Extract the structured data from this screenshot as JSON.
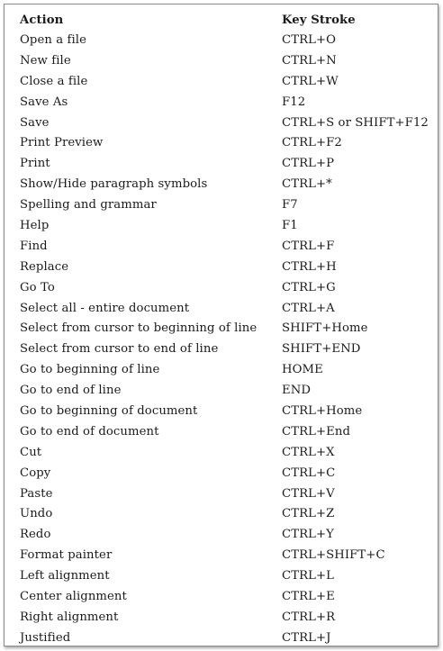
{
  "header": {
    "action": "Action",
    "key_stroke": "Key Stroke"
  },
  "rows": [
    {
      "action": "Open a file",
      "key": "CTRL+O"
    },
    {
      "action": "New file",
      "key": "CTRL+N"
    },
    {
      "action": "Close a file",
      "key": "CTRL+W"
    },
    {
      "action": "Save As",
      "key": "F12"
    },
    {
      "action": "Save",
      "key": "CTRL+S or SHIFT+F12"
    },
    {
      "action": "Print Preview",
      "key": "CTRL+F2"
    },
    {
      "action": "Print",
      "key": "CTRL+P"
    },
    {
      "action": "Show/Hide paragraph symbols",
      "key": "CTRL+*"
    },
    {
      "action": "Spelling and grammar",
      "key": "F7"
    },
    {
      "action": "Help",
      "key": "F1"
    },
    {
      "action": "Find",
      "key": "CTRL+F"
    },
    {
      "action": "Replace",
      "key": "CTRL+H"
    },
    {
      "action": "Go To",
      "key": "CTRL+G"
    },
    {
      "action": "Select all - entire document",
      "key": "CTRL+A"
    },
    {
      "action": "Select from cursor to beginning of line",
      "key": "SHIFT+Home"
    },
    {
      "action": "Select from cursor to end of line",
      "key": "SHIFT+END"
    },
    {
      "action": "Go to beginning of line",
      "key": "HOME"
    },
    {
      "action": "Go to end of line",
      "key": "END"
    },
    {
      "action": "Go to beginning of document",
      "key": "CTRL+Home"
    },
    {
      "action": "Go to end of document",
      "key": "CTRL+End"
    },
    {
      "action": "Cut",
      "key": "CTRL+X"
    },
    {
      "action": "Copy",
      "key": "CTRL+C"
    },
    {
      "action": "Paste",
      "key": "CTRL+V"
    },
    {
      "action": "Undo",
      "key": "CTRL+Z"
    },
    {
      "action": "Redo",
      "key": "CTRL+Y"
    },
    {
      "action": "Format painter",
      "key": "CTRL+SHIFT+C"
    },
    {
      "action": "Left alignment",
      "key": "CTRL+L"
    },
    {
      "action": "Center alignment",
      "key": "CTRL+E"
    },
    {
      "action": "Right alignment",
      "key": "CTRL+R"
    },
    {
      "action": "Justified",
      "key": "CTRL+J"
    }
  ]
}
